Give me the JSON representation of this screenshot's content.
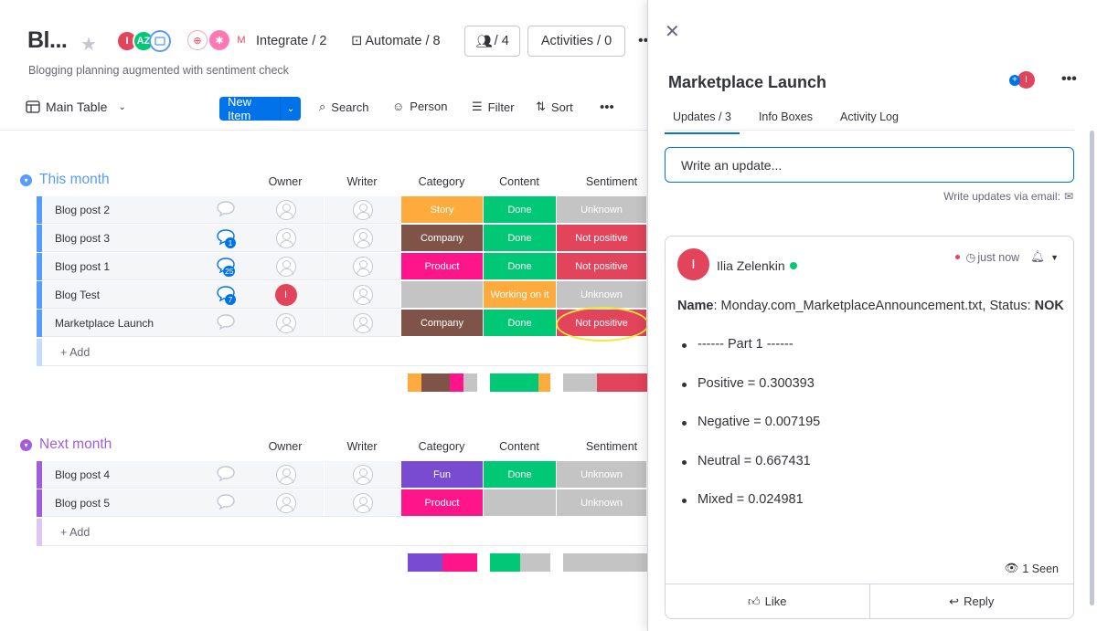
{
  "board": {
    "title": "Bl...",
    "description": "Blogging planning augmented with sentiment check",
    "avatars": [
      {
        "initials": "I",
        "color": "#e2445c"
      },
      {
        "initials": "AZ",
        "color": "#00c875"
      },
      {
        "initials": "",
        "color": "#579bfc"
      }
    ],
    "integrate_label": "Integrate / 2",
    "automate_label": "Automate / 8",
    "members_label": "/ 4",
    "activities_label": "Activities / 0"
  },
  "toolbar": {
    "view_label": "Main Table",
    "new_item_label": "New Item",
    "search_label": "Search",
    "person_label": "Person",
    "filter_label": "Filter",
    "sort_label": "Sort"
  },
  "columns": {
    "owner": "Owner",
    "writer": "Writer",
    "category": "Category",
    "content": "Content",
    "sentiment": "Sentiment"
  },
  "groups": [
    {
      "title": "This month",
      "color": "#579bfc",
      "add_label": "+ Add",
      "rows": [
        {
          "name": "Blog post 2",
          "updates": "",
          "owner": "",
          "category": "Story",
          "category_color": "#fdab3d",
          "content": "Done",
          "content_color": "#00c875",
          "sentiment": "Unknown",
          "sentiment_color": "#c4c4c4"
        },
        {
          "name": "Blog post 3",
          "updates": "1",
          "owner": "",
          "category": "Company",
          "category_color": "#7f5347",
          "content": "Done",
          "content_color": "#00c875",
          "sentiment": "Not positive",
          "sentiment_color": "#e2445c"
        },
        {
          "name": "Blog post 1",
          "updates": "25",
          "owner": "",
          "category": "Product",
          "category_color": "#ff158a",
          "content": "Done",
          "content_color": "#00c875",
          "sentiment": "Not positive",
          "sentiment_color": "#e2445c"
        },
        {
          "name": "Blog Test",
          "updates": "7",
          "owner": "I",
          "category": "",
          "category_color": "#c4c4c4",
          "content": "Working on it",
          "content_color": "#fdab3d",
          "sentiment": "Unknown",
          "sentiment_color": "#c4c4c4"
        },
        {
          "name": "Marketplace Launch",
          "updates": "",
          "owner": "",
          "category": "Company",
          "category_color": "#7f5347",
          "content": "Done",
          "content_color": "#00c875",
          "sentiment": "Not positive",
          "sentiment_color": "#e2445c"
        }
      ]
    },
    {
      "title": "Next month",
      "color": "#a25ddc",
      "add_label": "+ Add",
      "rows": [
        {
          "name": "Blog post 4",
          "updates": "",
          "owner": "",
          "category": "Fun",
          "category_color": "#784bd1",
          "content": "Done",
          "content_color": "#00c875",
          "sentiment": "Unknown",
          "sentiment_color": "#c4c4c4"
        },
        {
          "name": "Blog post 5",
          "updates": "",
          "owner": "",
          "category": "Product",
          "category_color": "#ff158a",
          "content": "",
          "content_color": "#c4c4c4",
          "sentiment": "Unknown",
          "sentiment_color": "#c4c4c4"
        }
      ]
    }
  ],
  "panel": {
    "title": "Marketplace Launch",
    "tabs": [
      {
        "label": "Updates / 3",
        "active": true
      },
      {
        "label": "Info Boxes",
        "active": false
      },
      {
        "label": "Activity Log",
        "active": false
      }
    ],
    "update_placeholder": "Write an update...",
    "email_link": "Write updates via email:",
    "post": {
      "author_initial": "I",
      "author": "Ilia Zelenkin",
      "time": "just now",
      "name_label": "Name",
      "name_value": ": Monday.com_MarketplaceAnnouncement.txt, Status: ",
      "status_value": "NOK",
      "bullets": [
        "------ Part 1 ------",
        "Positive = 0.300393",
        "Negative = 0.007195",
        "Neutral = 0.667431",
        "Mixed = 0.024981"
      ],
      "seen_label": "1 Seen",
      "like_label": "Like",
      "reply_label": "Reply"
    }
  },
  "colors": {
    "accent": "#0073ea",
    "done": "#00c875",
    "negative": "#e2445c",
    "unknown": "#c4c4c4",
    "highlight": "#f3e837"
  }
}
